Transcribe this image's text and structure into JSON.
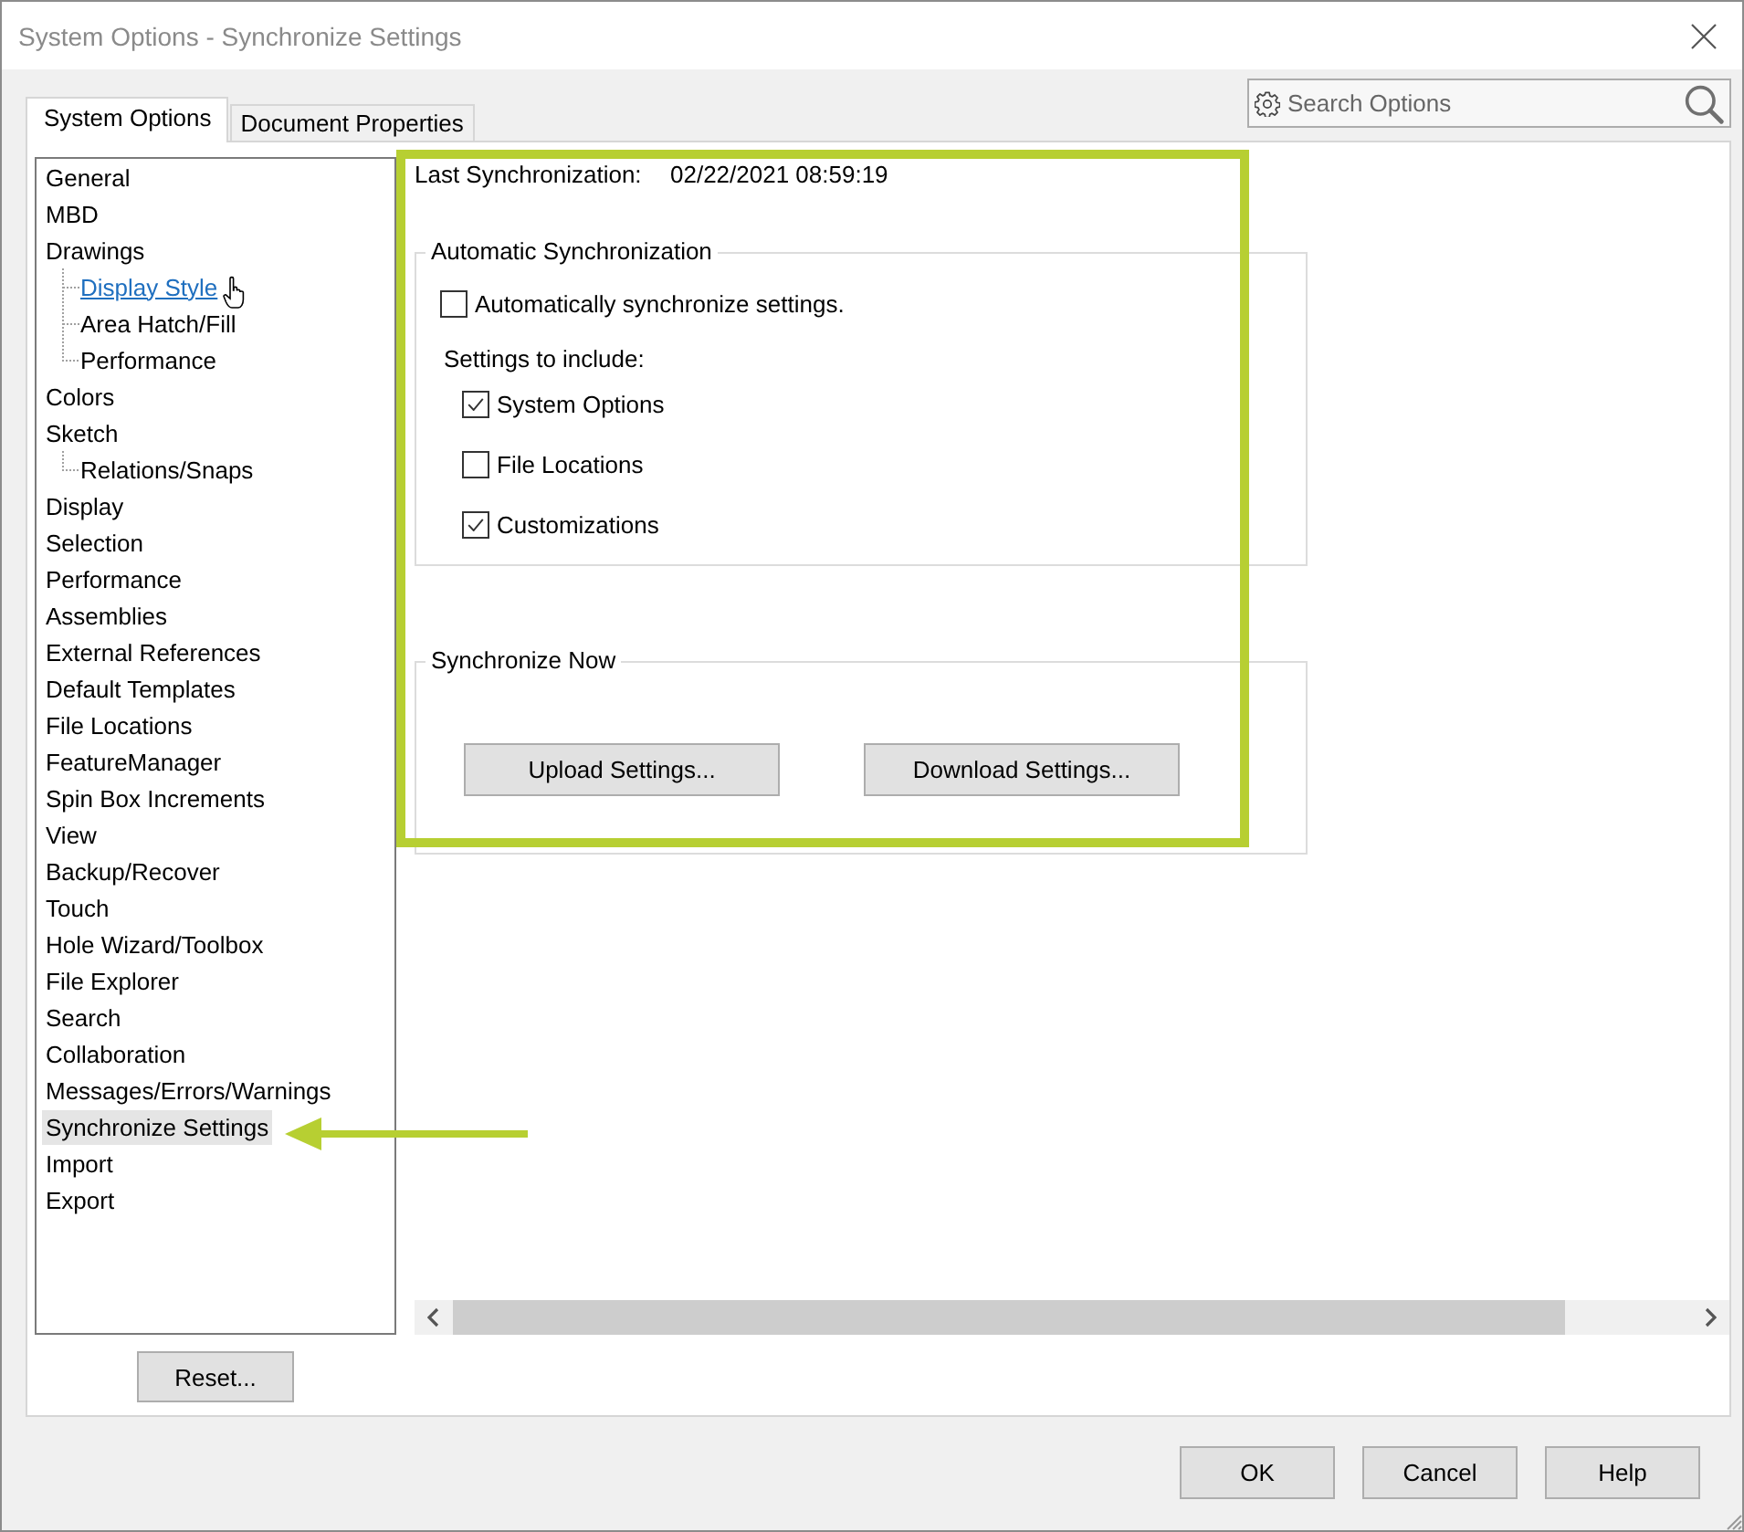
{
  "window": {
    "title": "System Options - Synchronize Settings"
  },
  "tabs": [
    {
      "label": "System Options",
      "selected": true
    },
    {
      "label": "Document Properties",
      "selected": false
    }
  ],
  "search": {
    "placeholder": "Search Options"
  },
  "tree": {
    "items": [
      {
        "label": "General",
        "selected": false,
        "hovered": false
      },
      {
        "label": "MBD",
        "selected": false,
        "hovered": false
      },
      {
        "label": "Drawings",
        "selected": false,
        "hovered": false,
        "children": [
          {
            "label": "Display Style",
            "selected": false,
            "hovered": true
          },
          {
            "label": "Area Hatch/Fill",
            "selected": false,
            "hovered": false
          },
          {
            "label": "Performance",
            "selected": false,
            "hovered": false
          }
        ]
      },
      {
        "label": "Colors",
        "selected": false,
        "hovered": false
      },
      {
        "label": "Sketch",
        "selected": false,
        "hovered": false,
        "children": [
          {
            "label": "Relations/Snaps",
            "selected": false,
            "hovered": false
          }
        ]
      },
      {
        "label": "Display",
        "selected": false,
        "hovered": false
      },
      {
        "label": "Selection",
        "selected": false,
        "hovered": false
      },
      {
        "label": "Performance",
        "selected": false,
        "hovered": false
      },
      {
        "label": "Assemblies",
        "selected": false,
        "hovered": false
      },
      {
        "label": "External References",
        "selected": false,
        "hovered": false
      },
      {
        "label": "Default Templates",
        "selected": false,
        "hovered": false
      },
      {
        "label": "File Locations",
        "selected": false,
        "hovered": false
      },
      {
        "label": "FeatureManager",
        "selected": false,
        "hovered": false
      },
      {
        "label": "Spin Box Increments",
        "selected": false,
        "hovered": false
      },
      {
        "label": "View",
        "selected": false,
        "hovered": false
      },
      {
        "label": "Backup/Recover",
        "selected": false,
        "hovered": false
      },
      {
        "label": "Touch",
        "selected": false,
        "hovered": false
      },
      {
        "label": "Hole Wizard/Toolbox",
        "selected": false,
        "hovered": false
      },
      {
        "label": "File Explorer",
        "selected": false,
        "hovered": false
      },
      {
        "label": "Search",
        "selected": false,
        "hovered": false
      },
      {
        "label": "Collaboration",
        "selected": false,
        "hovered": false
      },
      {
        "label": "Messages/Errors/Warnings",
        "selected": false,
        "hovered": false
      },
      {
        "label": "Synchronize Settings",
        "selected": true,
        "hovered": false
      },
      {
        "label": "Import",
        "selected": false,
        "hovered": false
      },
      {
        "label": "Export",
        "selected": false,
        "hovered": false
      }
    ]
  },
  "reset_button": "Reset...",
  "last_sync": {
    "label": "Last Synchronization:",
    "value": "02/22/2021 08:59:19"
  },
  "auto_sync": {
    "title": "Automatic Synchronization",
    "option": {
      "label": "Automatically synchronize settings.",
      "checked": false
    },
    "include_label": "Settings to include:",
    "include": [
      {
        "label": "System Options",
        "checked": true
      },
      {
        "label": "File Locations",
        "checked": false
      },
      {
        "label": "Customizations",
        "checked": true
      }
    ]
  },
  "sync_now": {
    "title": "Synchronize Now",
    "buttons": [
      "Upload Settings...",
      "Download Settings..."
    ]
  },
  "buttons": [
    "OK",
    "Cancel",
    "Help"
  ],
  "annotations": {
    "highlight_frame": true,
    "arrow": true
  }
}
